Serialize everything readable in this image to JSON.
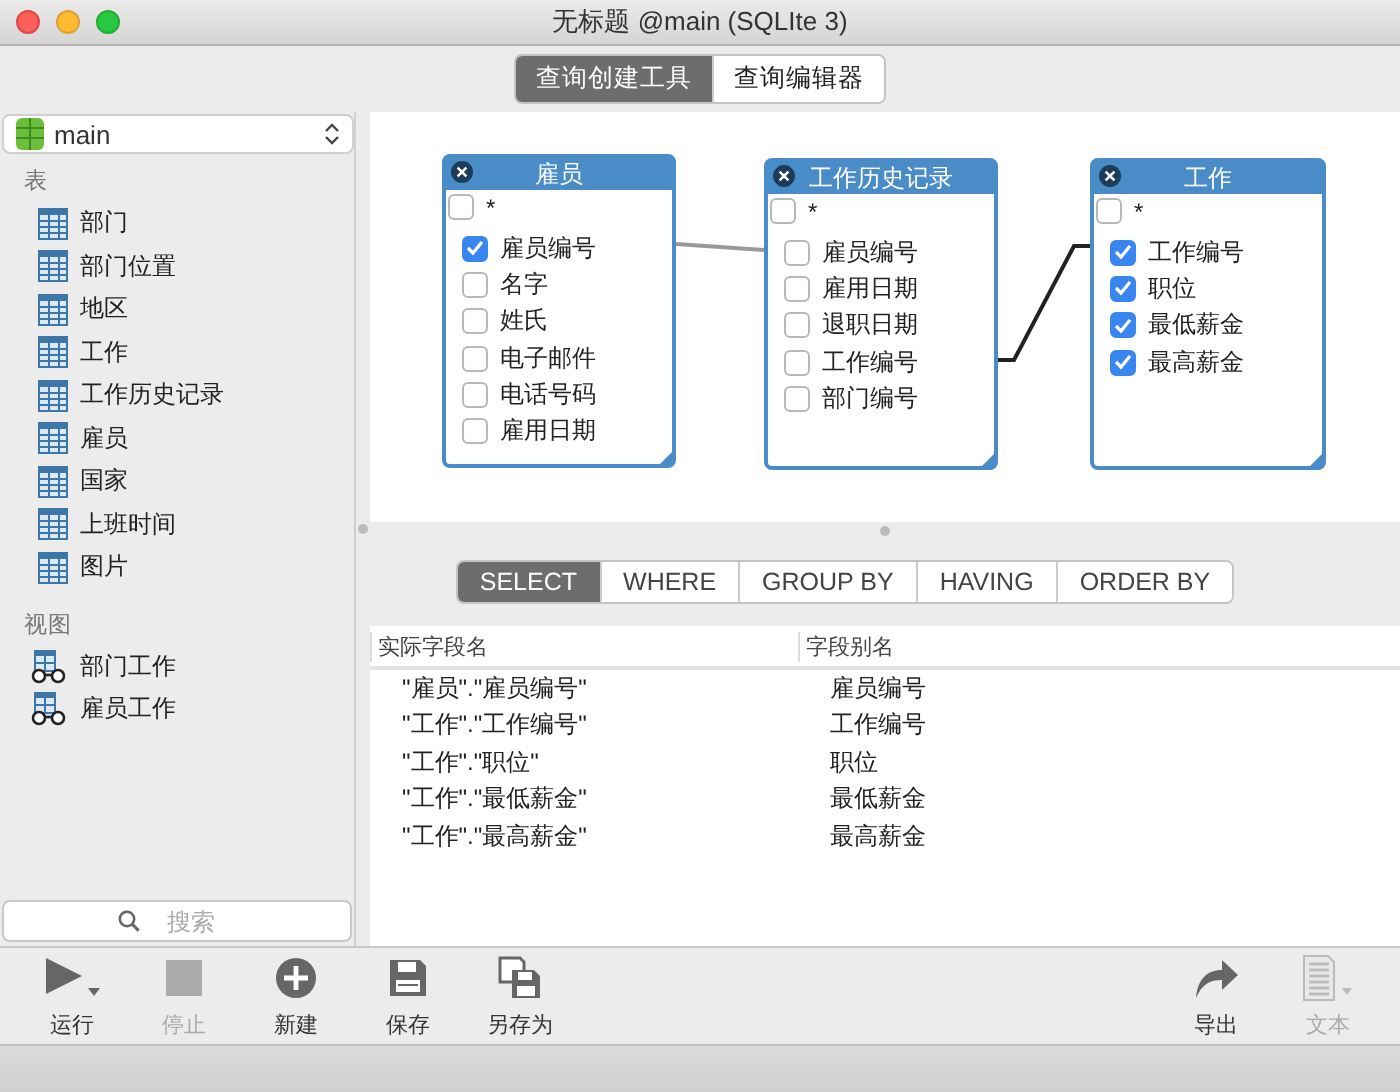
{
  "window": {
    "title": "无标题 @main (SQLIte 3)"
  },
  "mode_tabs": [
    {
      "label": "查询创建工具",
      "selected": true
    },
    {
      "label": "查询编辑器",
      "selected": false
    }
  ],
  "sidebar": {
    "database": "main",
    "sections": [
      {
        "heading": "表",
        "kind": "table",
        "items": [
          "部门",
          "部门位置",
          "地区",
          "工作",
          "工作历史记录",
          "雇员",
          "国家",
          "上班时间",
          "图片"
        ]
      },
      {
        "heading": "视图",
        "kind": "view",
        "items": [
          "部门工作",
          "雇员工作"
        ]
      }
    ],
    "search": {
      "placeholder": "搜索"
    }
  },
  "diagram": {
    "tables": [
      {
        "title": "雇员",
        "fields": [
          {
            "name": "*",
            "kind": "all",
            "checked": false
          },
          {
            "name": "雇员编号",
            "kind": "column",
            "checked": true
          },
          {
            "name": "名字",
            "kind": "column",
            "checked": false
          },
          {
            "name": "姓氏",
            "kind": "column",
            "checked": false
          },
          {
            "name": "电子邮件",
            "kind": "column",
            "checked": false
          },
          {
            "name": "电话号码",
            "kind": "column",
            "checked": false
          },
          {
            "name": "雇用日期",
            "kind": "column",
            "checked": false
          }
        ]
      },
      {
        "title": "工作历史记录",
        "fields": [
          {
            "name": "*",
            "kind": "all",
            "checked": false
          },
          {
            "name": "雇员编号",
            "kind": "column",
            "checked": false
          },
          {
            "name": "雇用日期",
            "kind": "column",
            "checked": false
          },
          {
            "name": "退职日期",
            "kind": "column",
            "checked": false
          },
          {
            "name": "工作编号",
            "kind": "column",
            "checked": false
          },
          {
            "name": "部门编号",
            "kind": "column",
            "checked": false
          }
        ]
      },
      {
        "title": "工作",
        "fields": [
          {
            "name": "*",
            "kind": "all",
            "checked": false
          },
          {
            "name": "工作编号",
            "kind": "column",
            "checked": true
          },
          {
            "name": "职位",
            "kind": "column",
            "checked": true
          },
          {
            "name": "最低薪金",
            "kind": "column",
            "checked": true
          },
          {
            "name": "最高薪金",
            "kind": "column",
            "checked": true
          }
        ]
      }
    ]
  },
  "clause_tabs": [
    {
      "label": "SELECT",
      "selected": true
    },
    {
      "label": "WHERE",
      "selected": false
    },
    {
      "label": "GROUP BY",
      "selected": false
    },
    {
      "label": "HAVING",
      "selected": false
    },
    {
      "label": "ORDER BY",
      "selected": false
    }
  ],
  "fields_table": {
    "columns": [
      "实际字段名",
      "字段别名"
    ],
    "rows": [
      [
        "\"雇员\".\"雇员编号\"",
        "雇员编号"
      ],
      [
        "\"工作\".\"工作编号\"",
        "工作编号"
      ],
      [
        "\"工作\".\"职位\"",
        "职位"
      ],
      [
        "\"工作\".\"最低薪金\"",
        "最低薪金"
      ],
      [
        "\"工作\".\"最高薪金\"",
        "最高薪金"
      ]
    ]
  },
  "toolbar": {
    "left": [
      {
        "label": "运行",
        "kind": "run",
        "disabled": false
      },
      {
        "label": "停止",
        "kind": "stop",
        "disabled": true
      },
      {
        "label": "新建",
        "kind": "new",
        "disabled": false
      },
      {
        "label": "保存",
        "kind": "save",
        "disabled": false
      },
      {
        "label": "另存为",
        "kind": "save-as",
        "disabled": false
      }
    ],
    "right": [
      {
        "label": "导出",
        "kind": "export",
        "disabled": false
      },
      {
        "label": "文本",
        "kind": "text",
        "disabled": true
      }
    ]
  }
}
